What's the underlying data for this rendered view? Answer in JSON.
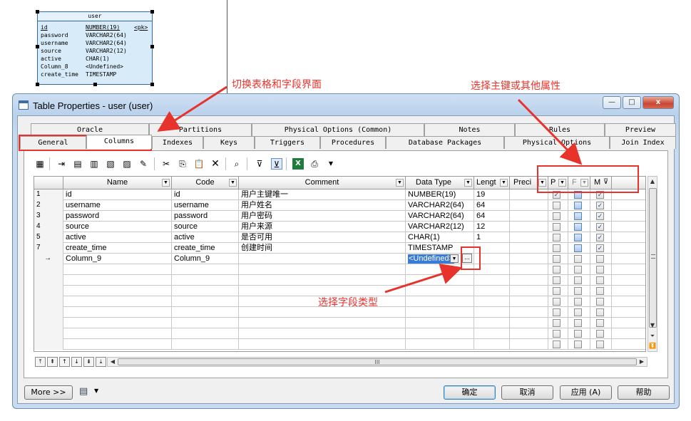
{
  "diagram": {
    "entity_title": "user",
    "pk_tag": "<pk>",
    "rows": [
      {
        "name": "id",
        "type": "NUMBER(19)"
      },
      {
        "name": "password",
        "type": "VARCHAR2(64)"
      },
      {
        "name": "username",
        "type": "VARCHAR2(64)"
      },
      {
        "name": "source",
        "type": "VARCHAR2(12)"
      },
      {
        "name": "active",
        "type": "CHAR(1)"
      },
      {
        "name": "Column_8",
        "type": "<Undefined>"
      },
      {
        "name": "create_time",
        "type": "TIMESTAMP"
      }
    ]
  },
  "annotations": {
    "switch_tabs": "切换表格和字段界面",
    "select_pk": "选择主键或其他属性",
    "select_type": "选择字段类型"
  },
  "dialog": {
    "title": "Table Properties - user (user)",
    "window_buttons": {
      "minimize": "—",
      "maximize": "□",
      "close": "x"
    }
  },
  "tabs_row1": [
    "Oracle",
    "Partitions",
    "Physical Options (Common)",
    "Notes",
    "Rules",
    "Preview"
  ],
  "tabs_row2": [
    "General",
    "Columns",
    "Indexes",
    "Keys",
    "Triggers",
    "Procedures",
    "Database Packages",
    "Physical Options",
    "Join Index"
  ],
  "active_tab": "Columns",
  "toolbar_icons": [
    "properties-icon",
    "insert-row-icon",
    "add-row-icon",
    "add-columns-icon",
    "add-column-icon",
    "copy-column-icon",
    "highlight-icon",
    "cut-icon",
    "copy-icon",
    "paste-icon",
    "delete-icon",
    "find-icon",
    "filter-icon",
    "filter-active-icon",
    "excel-icon",
    "print-icon",
    "dropdown-arrow-icon"
  ],
  "grid": {
    "headers": {
      "name": "Name",
      "code": "Code",
      "comment": "Comment",
      "data_type": "Data Type",
      "length": "Lengt",
      "precision": "Preci",
      "p": "P",
      "f": "F",
      "m": "M"
    },
    "rows": [
      {
        "num": "1",
        "name": "id",
        "code": "id",
        "comment": "用户主键唯一",
        "data_type": "NUMBER(19)",
        "length": "19",
        "p": true,
        "f": false,
        "m": true
      },
      {
        "num": "2",
        "name": "username",
        "code": "username",
        "comment": "用户姓名",
        "data_type": "VARCHAR2(64)",
        "length": "64",
        "p": false,
        "f": false,
        "m": true
      },
      {
        "num": "3",
        "name": "password",
        "code": "password",
        "comment": "用户密码",
        "data_type": "VARCHAR2(64)",
        "length": "64",
        "p": false,
        "f": false,
        "m": true
      },
      {
        "num": "4",
        "name": "source",
        "code": "source",
        "comment": "用户来源",
        "data_type": "VARCHAR2(12)",
        "length": "12",
        "p": false,
        "f": false,
        "m": true
      },
      {
        "num": "5",
        "name": "active",
        "code": "active",
        "comment": "是否可用",
        "data_type": "CHAR(1)",
        "length": "1",
        "p": false,
        "f": false,
        "m": true
      },
      {
        "num": "7",
        "name": "create_time",
        "code": "create_time",
        "comment": "创建时间",
        "data_type": "TIMESTAMP",
        "length": "",
        "p": false,
        "f": false,
        "m": true
      },
      {
        "num": "→",
        "name": "Column_9",
        "code": "Column_9",
        "comment": "",
        "data_type": "<Undefined>",
        "length": "",
        "p": false,
        "f": false,
        "m": false
      }
    ],
    "empty_rows": 8,
    "ellipsis_button": "...",
    "hscroll_grip": "III"
  },
  "nav_buttons": [
    "⤒",
    "⇞",
    "↑",
    "↓",
    "⇟",
    "⤓"
  ],
  "footer": {
    "more": "More >>",
    "ok": "确定",
    "cancel": "取消",
    "apply": "应用 (A)",
    "help": "帮助"
  }
}
